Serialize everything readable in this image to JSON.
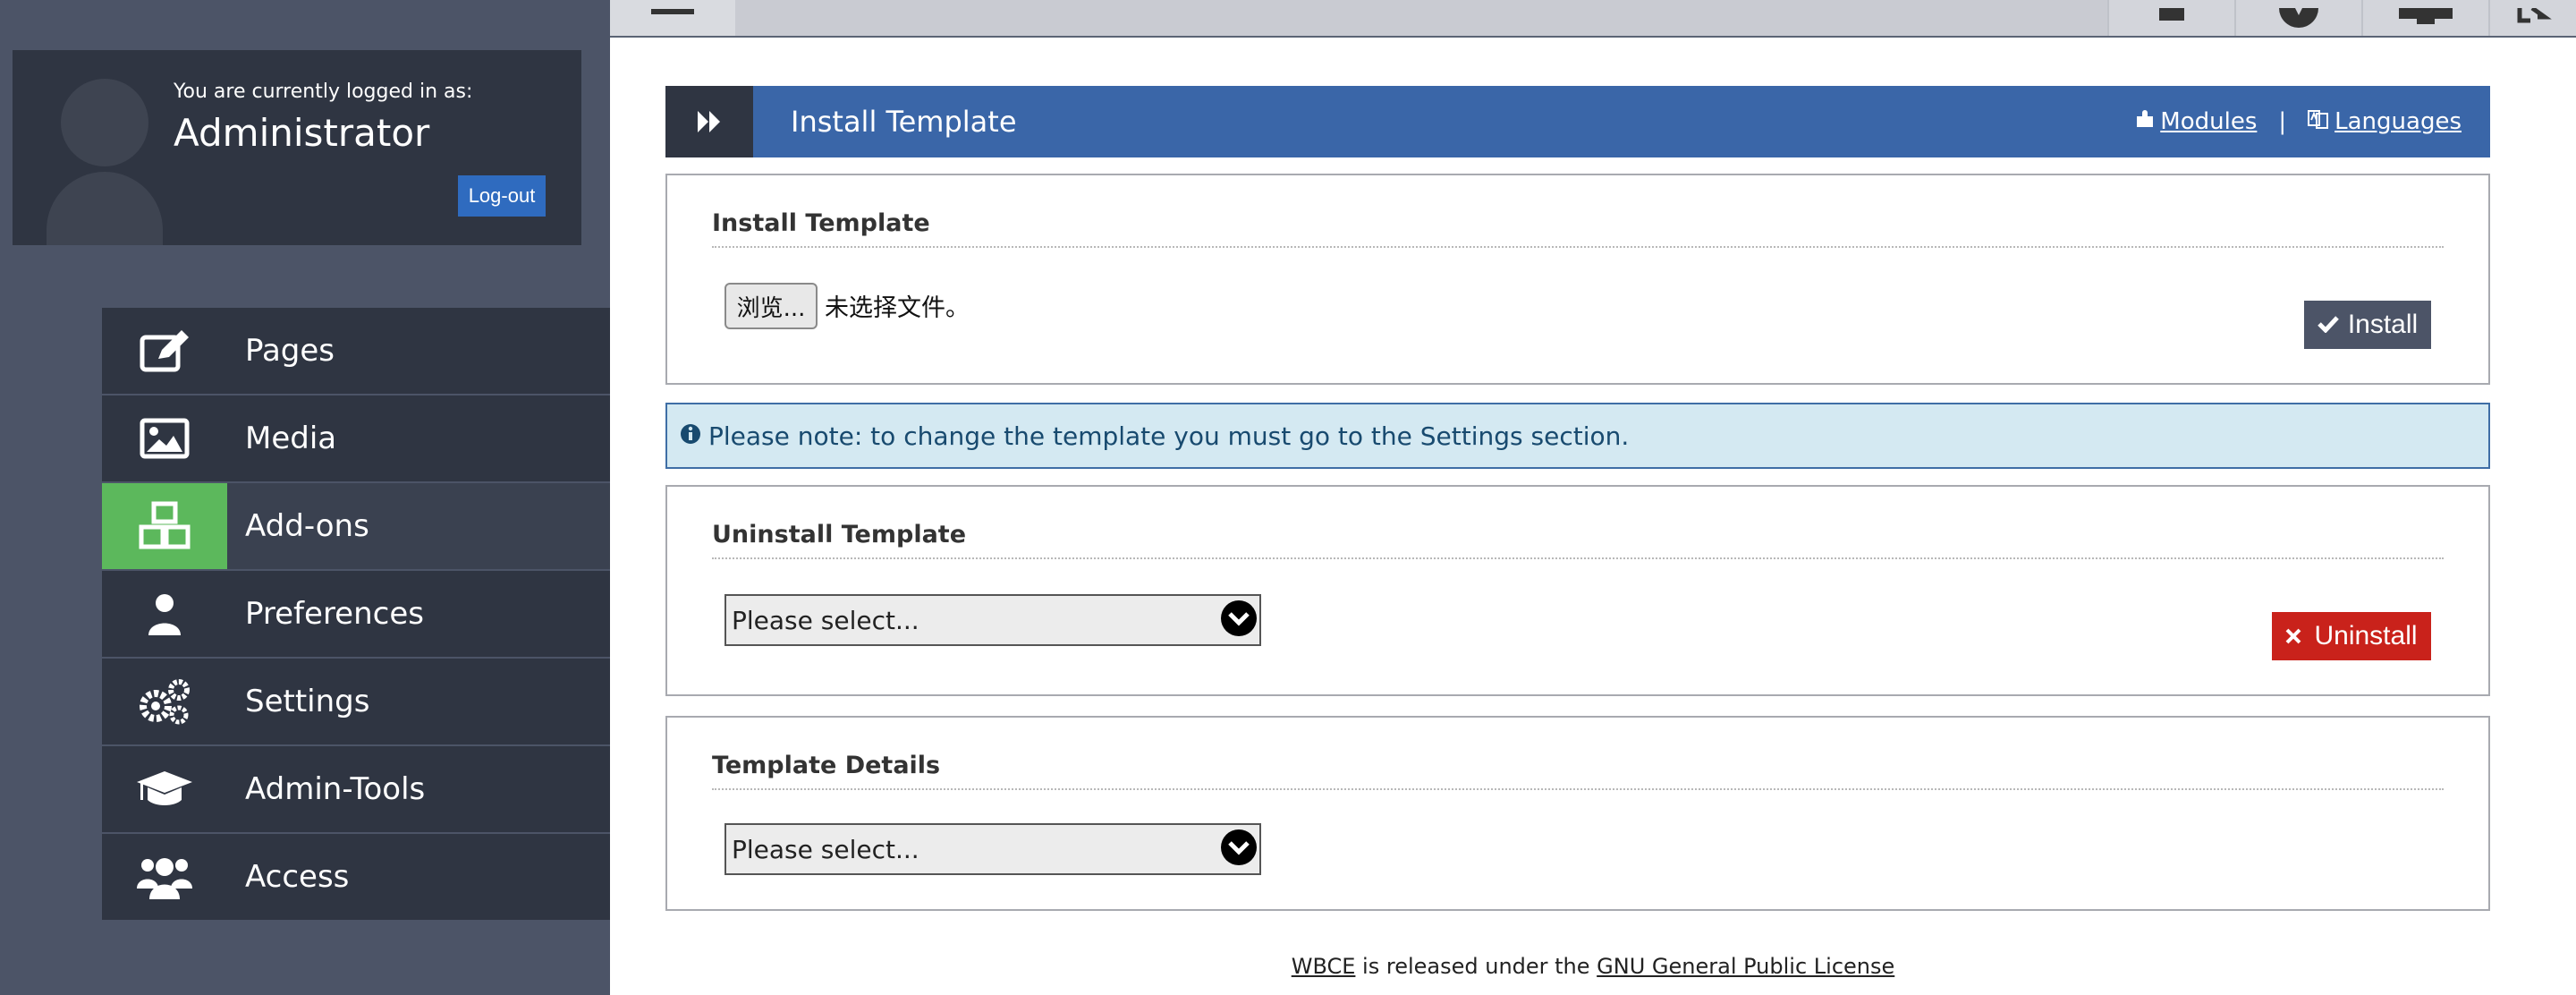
{
  "user": {
    "logged_in_label": "You are currently logged in as:",
    "name": "Administrator",
    "logout_label": "Log-out"
  },
  "nav": {
    "items": [
      {
        "label": "Pages",
        "icon": "edit-icon"
      },
      {
        "label": "Media",
        "icon": "image-icon"
      },
      {
        "label": "Add-ons",
        "icon": "cubes-icon",
        "active": true
      },
      {
        "label": "Preferences",
        "icon": "user-icon"
      },
      {
        "label": "Settings",
        "icon": "gears-icon"
      },
      {
        "label": "Admin-Tools",
        "icon": "graduation-cap-icon"
      },
      {
        "label": "Access",
        "icon": "users-icon"
      }
    ]
  },
  "topbar": {
    "icons": [
      "menu-icon",
      "home-icon",
      "compass-icon",
      "desktop-icon",
      "sign-out-icon"
    ]
  },
  "page": {
    "title": "Install Template",
    "links": {
      "modules": "Modules",
      "separator": "|",
      "languages": "Languages"
    }
  },
  "install_panel": {
    "heading": "Install Template",
    "browse_label": "浏览...",
    "file_status": "未选择文件。",
    "install_label": "Install"
  },
  "notice": {
    "text": "Please note: to change the template you must go to the Settings section."
  },
  "uninstall_panel": {
    "heading": "Uninstall Template",
    "select_value": "Please select...",
    "uninstall_label": "Uninstall"
  },
  "details_panel": {
    "heading": "Template Details",
    "select_value": "Please select..."
  },
  "footer": {
    "brand": "WBCE",
    "middle": " is released under the ",
    "license": "GNU General Public License"
  },
  "colors": {
    "sidebar_bg": "#4c5467",
    "nav_bg": "#2f3542",
    "active_green": "#5cb85c",
    "title_blue": "#3a66a8",
    "uninstall_red": "#c9221b",
    "notice_bg": "#d4e9f2"
  }
}
